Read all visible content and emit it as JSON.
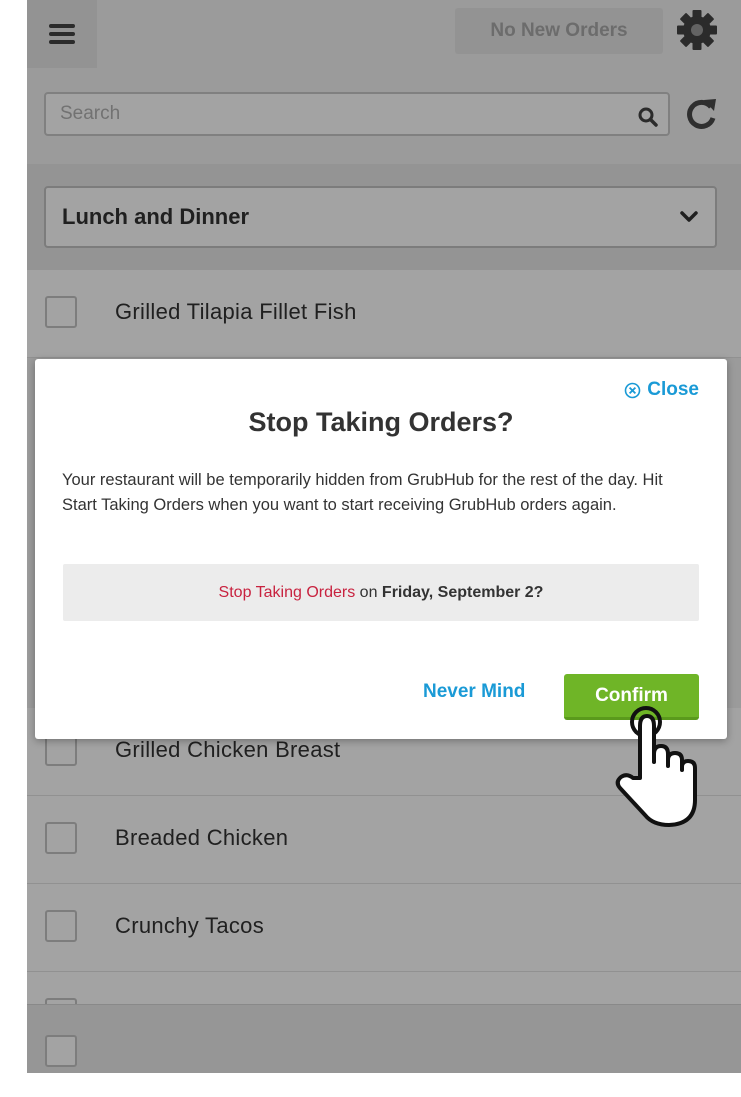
{
  "topbar": {
    "menu_icon": "hamburger-menu-icon",
    "orders_status": "No New Orders",
    "settings_icon": "gear-icon"
  },
  "search": {
    "placeholder": "Search",
    "value": "",
    "search_icon": "magnifier-icon",
    "refresh_icon": "refresh-icon"
  },
  "menu_selector": {
    "selected": "Lunch and Dinner",
    "chevron_icon": "chevron-down-icon"
  },
  "items": [
    {
      "name": "Grilled Tilapia Fillet Fish",
      "checked": false
    },
    {
      "name": "Grilled Chicken Breast",
      "checked": false
    },
    {
      "name": "Breaded Chicken",
      "checked": false
    },
    {
      "name": "Crunchy Tacos",
      "checked": false
    }
  ],
  "modal": {
    "close_label": "Close",
    "title": "Stop Taking Orders?",
    "body": "Your restaurant will be temporarily hidden from GrubHub for the rest of the day. Hit Start Taking Orders when you want to start receiving GrubHub orders again.",
    "confirm_prompt": {
      "action": "Stop Taking Orders",
      "connector": "on",
      "date": "Friday, September 2?"
    },
    "never_mind_label": "Never Mind",
    "confirm_label": "Confirm"
  },
  "colors": {
    "accent_blue": "#1a9ad6",
    "confirm_green": "#6fb527",
    "action_red": "#c8223f"
  }
}
